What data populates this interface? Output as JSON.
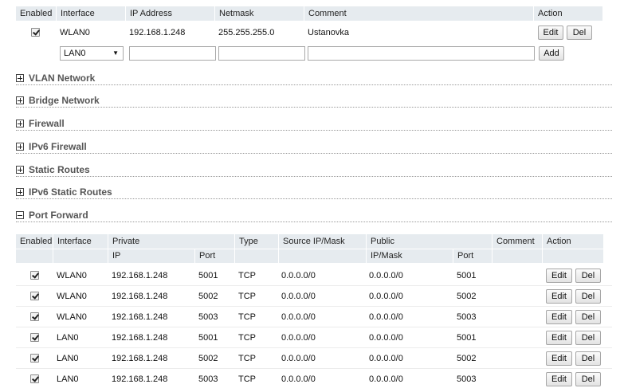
{
  "interfaces_table": {
    "headers": {
      "enabled": "Enabled",
      "interface": "Interface",
      "ip": "IP Address",
      "netmask": "Netmask",
      "comment": "Comment",
      "action": "Action"
    },
    "rows": [
      {
        "enabled": true,
        "interface": "WLAN0",
        "ip": "192.168.1.248",
        "netmask": "255.255.255.0",
        "comment": "Ustanovka",
        "edit": "Edit",
        "del": "Del"
      }
    ],
    "new_row": {
      "interface_select": "LAN0",
      "ip_value": "",
      "netmask_value": "",
      "comment_value": "",
      "add": "Add"
    }
  },
  "sections": {
    "vlan": "VLAN Network",
    "bridge": "Bridge Network",
    "firewall": "Firewall",
    "ipv6_firewall": "IPv6 Firewall",
    "static_routes": "Static Routes",
    "ipv6_static_routes": "IPv6 Static Routes",
    "port_forward": "Port Forward"
  },
  "port_forward": {
    "headers": {
      "enabled": "Enabled",
      "interface": "Interface",
      "private": "Private",
      "type": "Type",
      "source": "Source IP/Mask",
      "public": "Public",
      "comment": "Comment",
      "action": "Action",
      "private_ip": "IP",
      "private_port": "Port",
      "public_ipmask": "IP/Mask",
      "public_port": "Port"
    },
    "rows": [
      {
        "enabled": true,
        "interface": "WLAN0",
        "ip": "192.168.1.248",
        "port": "5001",
        "type": "TCP",
        "source": "0.0.0.0/0",
        "public": "0.0.0.0/0",
        "pport": "5001",
        "edit": "Edit",
        "del": "Del"
      },
      {
        "enabled": true,
        "interface": "WLAN0",
        "ip": "192.168.1.248",
        "port": "5002",
        "type": "TCP",
        "source": "0.0.0.0/0",
        "public": "0.0.0.0/0",
        "pport": "5002",
        "edit": "Edit",
        "del": "Del"
      },
      {
        "enabled": true,
        "interface": "WLAN0",
        "ip": "192.168.1.248",
        "port": "5003",
        "type": "TCP",
        "source": "0.0.0.0/0",
        "public": "0.0.0.0/0",
        "pport": "5003",
        "edit": "Edit",
        "del": "Del"
      },
      {
        "enabled": true,
        "interface": "LAN0",
        "ip": "192.168.1.248",
        "port": "5001",
        "type": "TCP",
        "source": "0.0.0.0/0",
        "public": "0.0.0.0/0",
        "pport": "5001",
        "edit": "Edit",
        "del": "Del"
      },
      {
        "enabled": true,
        "interface": "LAN0",
        "ip": "192.168.1.248",
        "port": "5002",
        "type": "TCP",
        "source": "0.0.0.0/0",
        "public": "0.0.0.0/0",
        "pport": "5002",
        "edit": "Edit",
        "del": "Del"
      },
      {
        "enabled": true,
        "interface": "LAN0",
        "ip": "192.168.1.248",
        "port": "5003",
        "type": "TCP",
        "source": "0.0.0.0/0",
        "public": "0.0.0.0/0",
        "pport": "5003",
        "edit": "Edit",
        "del": "Del"
      }
    ]
  },
  "icons": {
    "checkbox": "checkbox-checked-icon",
    "expand": "plus-box-icon",
    "collapse": "minus-box-icon",
    "dropdown": "chevron-down-icon"
  },
  "colors": {
    "header_bg": "#e6ebef",
    "section_title": "#555555",
    "button_border": "#a6a6a6"
  }
}
